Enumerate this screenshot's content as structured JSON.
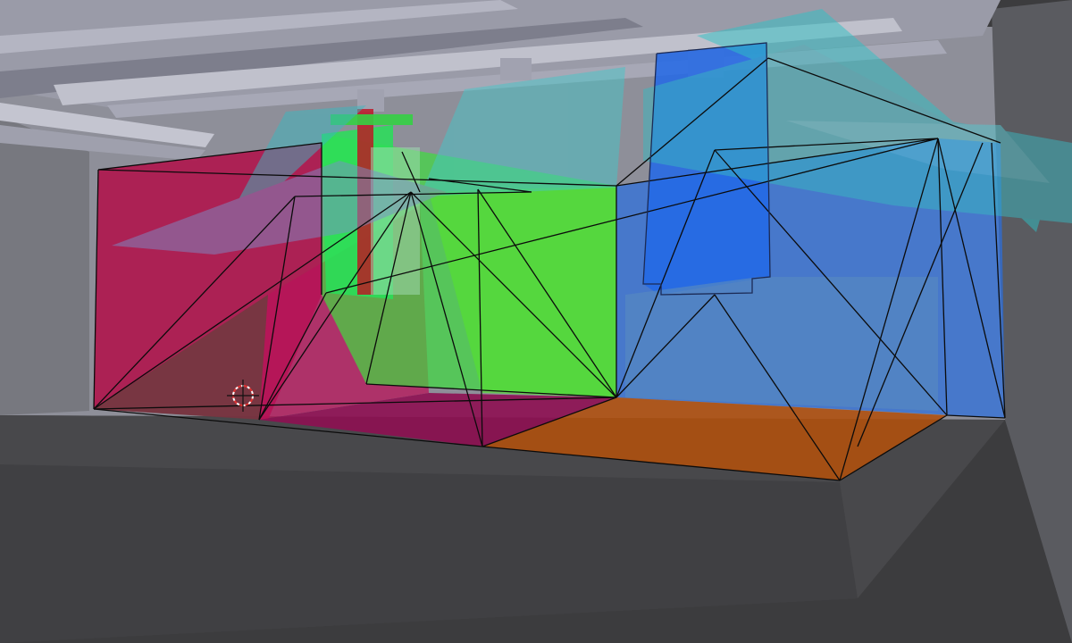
{
  "viewport": {
    "mode": "3d-viewport",
    "shading": "wireframe-transparent",
    "cursor_icon": "3d-cursor-icon"
  },
  "colors": {
    "background": "#3c3c3e",
    "floor": "#454547",
    "ceiling_structure": "#8a8b9a",
    "wall_light": "#9a9ba6",
    "red_region": "#b0124a",
    "green_region": "#3fdc3f",
    "blue_region": "#2a6ee0",
    "cyan_light": "#39b8c0",
    "orange_floor": "#b0500c",
    "magenta_floor": "#8e0f52",
    "wire": "#0b0b0b"
  },
  "objects": [
    "ceiling-beams",
    "back-wall",
    "red-zone",
    "green-zone",
    "blue-zone",
    "cyan-spotlight-cones",
    "orange-floor-zone",
    "wireframe-mesh",
    "3d-cursor"
  ]
}
